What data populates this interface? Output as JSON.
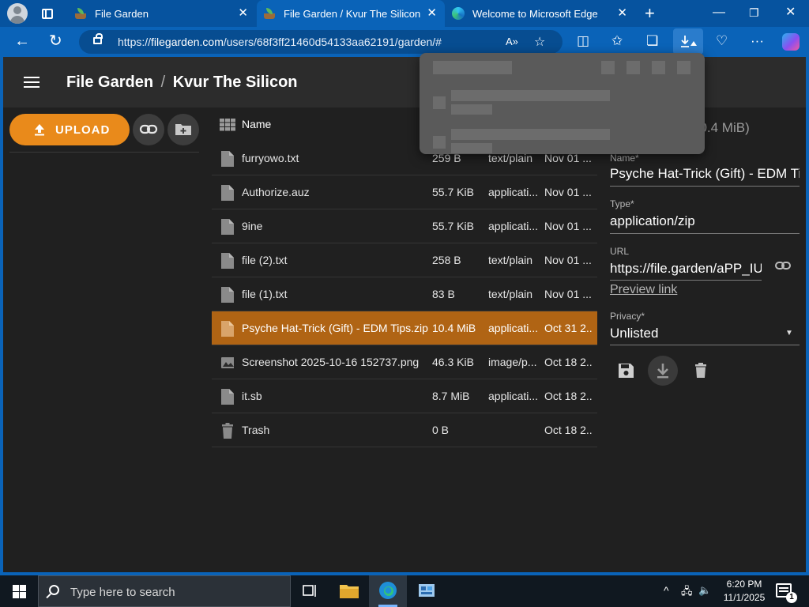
{
  "browser": {
    "tabs": [
      {
        "title": "File Garden"
      },
      {
        "title": "File Garden / Kvur The Silicon"
      },
      {
        "title": "Welcome to Microsoft Edge"
      }
    ],
    "url_prefix": "https://",
    "url_host": "filegarden.com",
    "url_path": "/users/68f3ff21460d54133aa62191/garden/#"
  },
  "app": {
    "title": "File Garden",
    "separator": "/",
    "folder": "Kvur The Silicon",
    "upload_label": "UPLOAD",
    "name_column": "Name"
  },
  "files": [
    {
      "name": "furryowo.txt",
      "size": "259 B",
      "type": "text/plain",
      "date": "Nov 01 ...",
      "icon": "file-icon"
    },
    {
      "name": "Authorize.auz",
      "size": "55.7 KiB",
      "type": "applicati...",
      "date": "Nov 01 ...",
      "icon": "file-icon"
    },
    {
      "name": "9ine",
      "size": "55.7 KiB",
      "type": "applicati...",
      "date": "Nov 01 ...",
      "icon": "file-icon"
    },
    {
      "name": "file (2).txt",
      "size": "258 B",
      "type": "text/plain",
      "date": "Nov 01 ...",
      "icon": "file-icon"
    },
    {
      "name": "file (1).txt",
      "size": "83 B",
      "type": "text/plain",
      "date": "Nov 01 ...",
      "icon": "file-icon"
    },
    {
      "name": "Psyche Hat-Trick (Gift) - EDM Tips.zip",
      "size": "10.4 MiB",
      "type": "applicati...",
      "date": "Oct 31 2...",
      "icon": "file-icon",
      "selected": true
    },
    {
      "name": "Screenshot 2025-10-16 152737.png",
      "size": "46.3 KiB",
      "type": "image/p...",
      "date": "Oct 18 2...",
      "icon": "image-icon"
    },
    {
      "name": "it.sb",
      "size": "8.7 MiB",
      "type": "applicati...",
      "date": "Oct 18 2...",
      "icon": "file-icon"
    },
    {
      "name": "Trash",
      "size": "0 B",
      "type": "",
      "date": "Oct 18 2...",
      "icon": "trash-icon"
    }
  ],
  "details": {
    "size_partial": "10.4 MiB)",
    "name_label": "Name*",
    "name_value": "Psyche Hat-Trick (Gift) - EDM Tips",
    "type_label": "Type*",
    "type_value": "application/zip",
    "url_label": "URL",
    "url_value": "https://file.garden/aPP_IUY",
    "preview_label": "Preview link",
    "privacy_label": "Privacy*",
    "privacy_value": "Unlisted"
  },
  "taskbar": {
    "search_placeholder": "Type here to search",
    "time": "6:20 PM",
    "date": "11/1/2025",
    "notification_count": "1"
  },
  "colors": {
    "accent": "#e98a1b",
    "selected_row": "#b06414",
    "browser_frame": "#0a63b8"
  }
}
